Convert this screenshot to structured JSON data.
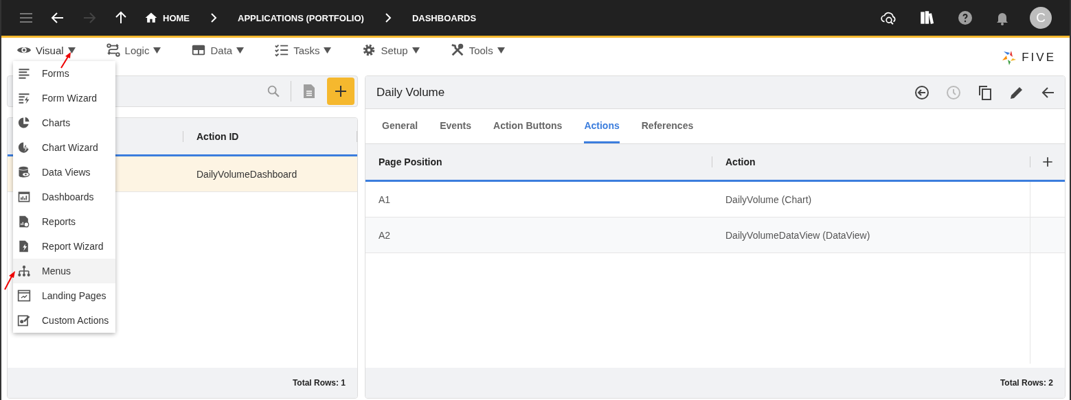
{
  "top_bar": {
    "breadcrumbs": [
      {
        "label": "HOME",
        "kind": "home"
      },
      {
        "label": "APPLICATIONS (PORTFOLIO)",
        "kind": "crumb"
      },
      {
        "label": "DASHBOARDS",
        "kind": "crumb"
      }
    ],
    "avatar": "C"
  },
  "menu_bar": {
    "items": [
      {
        "label": "Visual",
        "expanded": true
      },
      {
        "label": "Logic",
        "expanded": false
      },
      {
        "label": "Data",
        "expanded": false
      },
      {
        "label": "Tasks",
        "expanded": false
      },
      {
        "label": "Setup",
        "expanded": false
      },
      {
        "label": "Tools",
        "expanded": false
      }
    ],
    "logo": "FIVE"
  },
  "dropdown": {
    "items": [
      {
        "label": "Forms",
        "selected": false
      },
      {
        "label": "Form Wizard",
        "selected": false
      },
      {
        "label": "Charts",
        "selected": false
      },
      {
        "label": "Chart Wizard",
        "selected": false
      },
      {
        "label": "Data Views",
        "selected": false
      },
      {
        "label": "Dashboards",
        "selected": false
      },
      {
        "label": "Reports",
        "selected": false
      },
      {
        "label": "Report Wizard",
        "selected": false
      },
      {
        "label": "Menus",
        "selected": true
      },
      {
        "label": "Landing Pages",
        "selected": false
      },
      {
        "label": "Custom Actions",
        "selected": false
      }
    ]
  },
  "list_panel": {
    "columns": [
      "Action ID"
    ],
    "rows": [
      {
        "action_id": "DailyVolumeDashboard",
        "selected": true
      }
    ],
    "total": "Total Rows: 1"
  },
  "detail_panel": {
    "title": "Daily Volume",
    "tabs": [
      {
        "label": "General",
        "selected": false
      },
      {
        "label": "Events",
        "selected": false
      },
      {
        "label": "Action Buttons",
        "selected": false
      },
      {
        "label": "Actions",
        "selected": true
      },
      {
        "label": "References",
        "selected": false
      }
    ],
    "columns": [
      "Page Position",
      "Action"
    ],
    "rows": [
      {
        "page_position": "A1",
        "action": "DailyVolume (Chart)"
      },
      {
        "page_position": "A2",
        "action": "DailyVolumeDataView (DataView)"
      }
    ],
    "total": "Total Rows: 2"
  }
}
